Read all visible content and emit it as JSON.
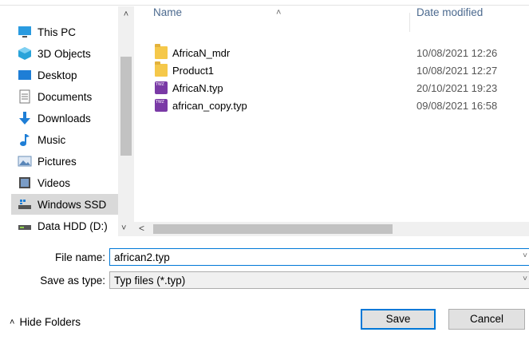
{
  "sidebar": {
    "items": [
      {
        "label": "This PC",
        "icon": "monitor-icon",
        "selected": false
      },
      {
        "label": "3D Objects",
        "icon": "cube-icon",
        "selected": false
      },
      {
        "label": "Desktop",
        "icon": "desktop-icon",
        "selected": false
      },
      {
        "label": "Documents",
        "icon": "document-icon",
        "selected": false
      },
      {
        "label": "Downloads",
        "icon": "download-arrow-icon",
        "selected": false
      },
      {
        "label": "Music",
        "icon": "music-note-icon",
        "selected": false
      },
      {
        "label": "Pictures",
        "icon": "picture-icon",
        "selected": false
      },
      {
        "label": "Videos",
        "icon": "video-icon",
        "selected": false
      },
      {
        "label": "Windows SSD",
        "icon": "drive-icon",
        "selected": true
      },
      {
        "label": "Data HDD (D:)",
        "icon": "hdd-icon",
        "selected": false
      }
    ]
  },
  "columns": {
    "name": "Name",
    "date": "Date modified"
  },
  "files": [
    {
      "name": "AfricaN_mdr",
      "date": "10/08/2021 12:26",
      "kind": "folder"
    },
    {
      "name": "Product1",
      "date": "10/08/2021 12:27",
      "kind": "folder"
    },
    {
      "name": "AfricaN.typ",
      "date": "20/10/2021 19:23",
      "kind": "typ"
    },
    {
      "name": "african_copy.typ",
      "date": "09/08/2021 16:58",
      "kind": "typ"
    }
  ],
  "form": {
    "file_name_label": "File name:",
    "file_name_value": "african2.typ",
    "save_type_label": "Save as type:",
    "save_type_value": "Typ files (*.typ)"
  },
  "buttons": {
    "hide_folders": "Hide Folders",
    "save": "Save",
    "cancel": "Cancel"
  },
  "colors": {
    "accent": "#0078d7",
    "selected_bg": "#d9d9d9",
    "header_text": "#4c6a8f"
  }
}
